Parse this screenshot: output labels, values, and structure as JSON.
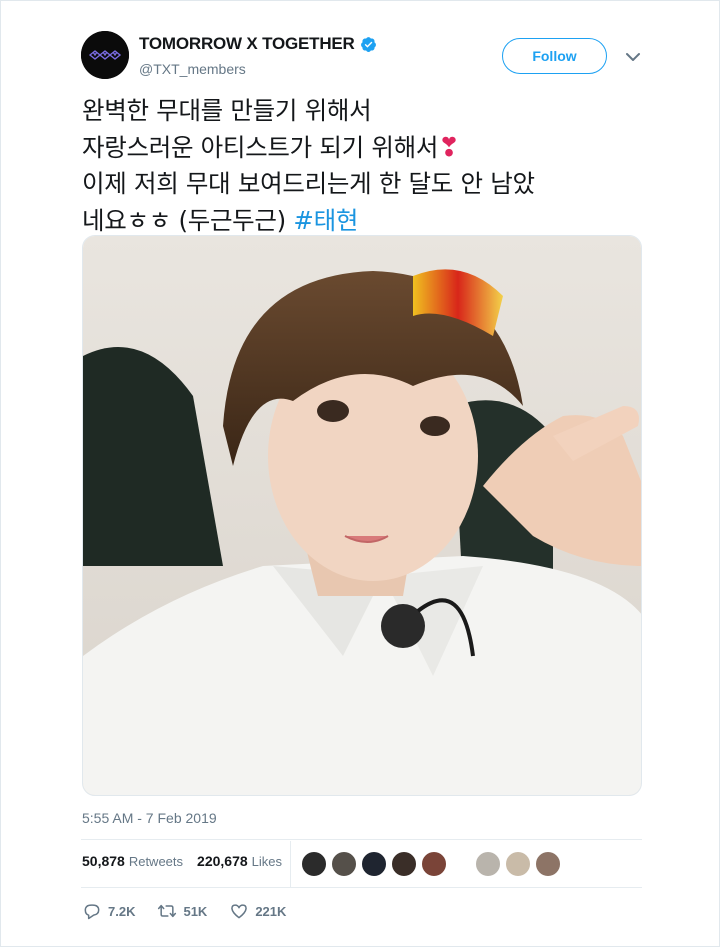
{
  "account": {
    "display_name": "TOMORROW X TOGETHER",
    "handle": "@TXT_members",
    "verified": true
  },
  "header": {
    "follow_label": "Follow"
  },
  "tweet": {
    "lines": [
      "완벽한 무대를 만들기 위해서",
      "자랑스러운 아티스트가 되기 위해서",
      "이제 저희 무대 보여드리는게 한 달도 안 남았",
      "네요ㅎㅎ (두근두근) "
    ],
    "hashtag": "#태현",
    "emoji": "❣"
  },
  "timestamp": "5:55 AM - 7 Feb 2019",
  "stats": {
    "retweets_count": "50,878",
    "retweets_label": "Retweets",
    "likes_count": "220,678",
    "likes_label": "Likes"
  },
  "actions": {
    "reply_count": "7.2K",
    "retweet_count": "51K",
    "like_count": "221K"
  },
  "colors": {
    "accent": "#1da1f2",
    "hashtag": "#1b95e0",
    "muted": "#657786",
    "heart": "#e0245e"
  }
}
